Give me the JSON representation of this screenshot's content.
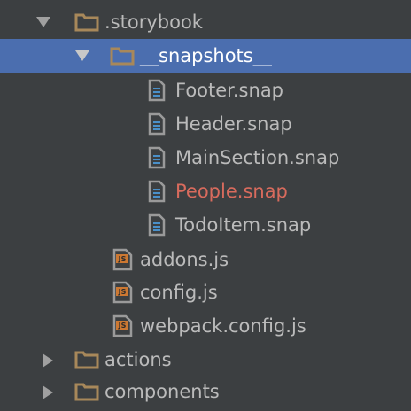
{
  "colors": {
    "background": "#3c3f41",
    "selection": "#4b6eaf",
    "text": "#bbbbbb",
    "selected_text": "#ffffff",
    "changed_text": "#d86b5d",
    "folder_icon": "#a8885a",
    "file_icon_accent": "#4a90c9",
    "js_icon": "#cc7832"
  },
  "tree": {
    "nodes": [
      {
        "name": "folder-storybook",
        "label": ".storybook",
        "type": "folder",
        "expanded": true,
        "arrow": "chevron-down-icon"
      },
      {
        "name": "folder-snapshots",
        "label": "__snapshots__",
        "type": "folder",
        "expanded": true,
        "selected": true,
        "arrow": "chevron-down-icon"
      },
      {
        "name": "file-footer-snap",
        "label": "Footer.snap",
        "type": "snap-file"
      },
      {
        "name": "file-header-snap",
        "label": "Header.snap",
        "type": "snap-file"
      },
      {
        "name": "file-mainsection-snap",
        "label": "MainSection.snap",
        "type": "snap-file"
      },
      {
        "name": "file-people-snap",
        "label": "People.snap",
        "type": "snap-file",
        "status": "modified"
      },
      {
        "name": "file-todoitem-snap",
        "label": "TodoItem.snap",
        "type": "snap-file"
      },
      {
        "name": "file-addons-js",
        "label": "addons.js",
        "type": "js-file",
        "badge": "JS"
      },
      {
        "name": "file-config-js",
        "label": "config.js",
        "type": "js-file",
        "badge": "JS"
      },
      {
        "name": "file-webpack-config-js",
        "label": "webpack.config.js",
        "type": "js-file",
        "badge": "JS"
      },
      {
        "name": "folder-actions",
        "label": "actions",
        "type": "folder",
        "expanded": false,
        "arrow": "chevron-right-icon"
      },
      {
        "name": "folder-components",
        "label": "components",
        "type": "folder",
        "expanded": false,
        "arrow": "chevron-right-icon"
      }
    ]
  }
}
